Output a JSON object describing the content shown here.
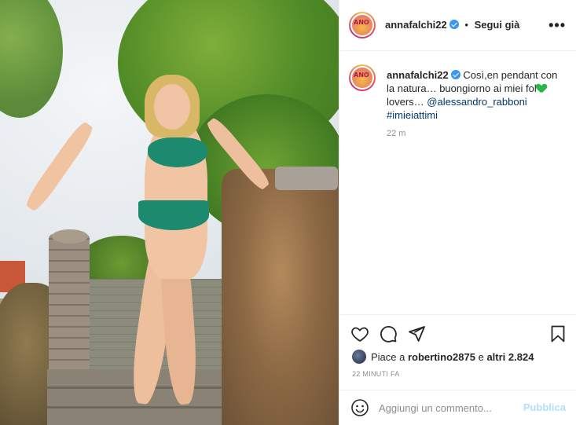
{
  "post": {
    "username": "annafalchi22",
    "avatar_text": "ANO",
    "separator": "•",
    "follow_label": "Segui già",
    "more_label": "•••",
    "caption": {
      "intro": "Così,en pendant con la natura… buongiorno ai miei fol",
      "tail": " lovers… ",
      "mention": "@alessandro_rabboni",
      "hashtag": "#imieiattimi",
      "time": "22 m"
    },
    "likes": {
      "prefix": "Piace a ",
      "user": "robertino2875",
      "middle": " e ",
      "others": "altri 2.824"
    },
    "posted_ago": "22 MINUTI FA",
    "add_comment_placeholder": "Aggiungi un commento...",
    "publish_label": "Pubblica"
  },
  "icons": [
    "heart-icon",
    "comment-icon",
    "share-icon",
    "bookmark-icon",
    "emoji-icon",
    "verified-badge-icon",
    "green-heart-emoji"
  ],
  "colors": {
    "verified": "#3897f0",
    "mention": "#00376b",
    "publish_disabled": "#b2dffc",
    "green_heart": "#28b54a"
  }
}
